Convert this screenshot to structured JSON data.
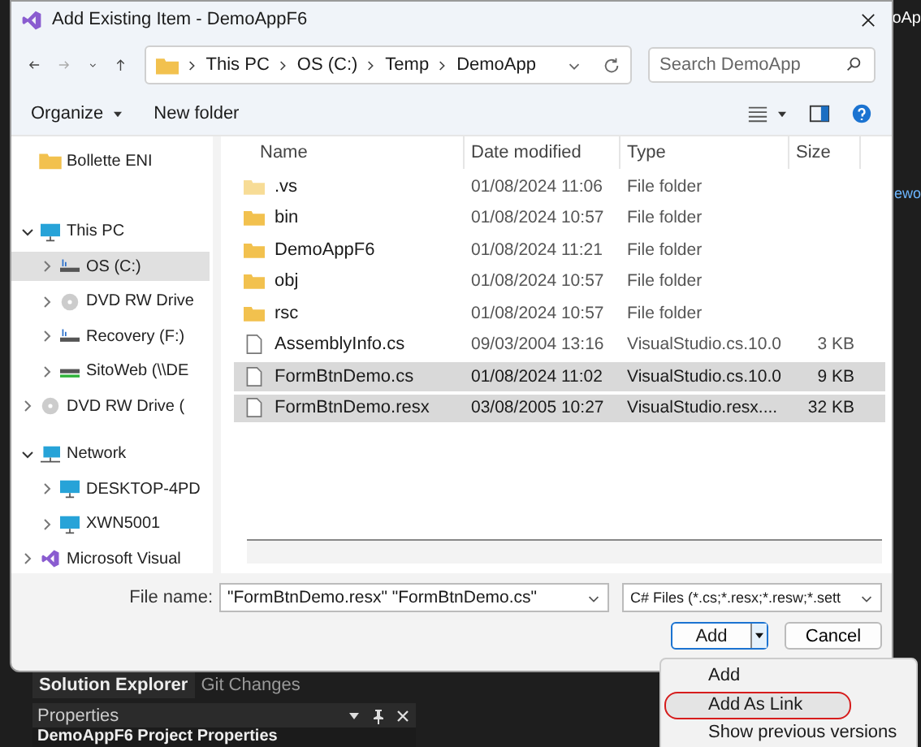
{
  "background": {
    "fragments": [
      "oAp",
      "ewo"
    ]
  },
  "window": {
    "title": "Add Existing Item - DemoAppF6"
  },
  "address": {
    "crumbs": [
      "This PC",
      "OS (C:)",
      "Temp",
      "DemoApp"
    ]
  },
  "search": {
    "placeholder": "Search DemoApp"
  },
  "toolbar": {
    "organize": "Organize",
    "new_folder": "New folder"
  },
  "sidebar": {
    "items": [
      {
        "label": "Bollette ENI",
        "kind": "folder",
        "selected": false
      },
      {
        "label": "This PC",
        "kind": "computer",
        "selected": false,
        "expanded": true,
        "children": [
          {
            "label": "OS (C:)",
            "kind": "drive",
            "selected": true,
            "expanded": false
          },
          {
            "label": "DVD RW Drive",
            "kind": "disc",
            "selected": false,
            "expanded": false
          },
          {
            "label": "Recovery (F:)",
            "kind": "drive",
            "selected": false,
            "expanded": false
          },
          {
            "label": "SitoWeb (\\\\DE",
            "kind": "share",
            "selected": false,
            "expanded": false
          }
        ]
      },
      {
        "label": "DVD RW Drive (",
        "kind": "disc",
        "selected": false,
        "expanded": false
      },
      {
        "label": "Network",
        "kind": "network",
        "selected": false,
        "expanded": true,
        "children": [
          {
            "label": "DESKTOP-4PD",
            "kind": "computer",
            "selected": false,
            "expanded": false
          },
          {
            "label": "XWN5001",
            "kind": "computer",
            "selected": false,
            "expanded": false
          }
        ]
      },
      {
        "label": "Microsoft Visual",
        "kind": "app",
        "selected": false,
        "expanded": false
      }
    ]
  },
  "table": {
    "columns": [
      "Name",
      "Date modified",
      "Type",
      "Size"
    ],
    "rows": [
      {
        "kind": "folder",
        "name": ".vs",
        "date": "01/08/2024 11:06",
        "type": "File folder",
        "selected": false
      },
      {
        "kind": "folder",
        "name": "bin",
        "date": "01/08/2024 10:57",
        "type": "File folder",
        "selected": false
      },
      {
        "kind": "folder",
        "name": "DemoAppF6",
        "date": "01/08/2024 11:21",
        "type": "File folder",
        "selected": false
      },
      {
        "kind": "folder",
        "name": "obj",
        "date": "01/08/2024 10:57",
        "type": "File folder",
        "selected": false
      },
      {
        "kind": "folder",
        "name": "rsc",
        "date": "01/08/2024 10:57",
        "type": "File folder",
        "selected": false
      },
      {
        "kind": "file",
        "name": "AssemblyInfo.cs",
        "date": "09/03/2004 13:16",
        "type": "VisualStudio.cs.10.0",
        "size": "3 KB",
        "selected": false
      },
      {
        "kind": "file",
        "name": "FormBtnDemo.cs",
        "date": "01/08/2024 11:02",
        "type": "VisualStudio.cs.10.0",
        "size": "9 KB",
        "selected": true
      },
      {
        "kind": "file",
        "name": "FormBtnDemo.resx",
        "date": "03/08/2005 10:27",
        "type": "VisualStudio.resx....",
        "size": "32 KB",
        "selected": true
      }
    ]
  },
  "file_name": {
    "label": "File name:",
    "value": "\"FormBtnDemo.resx\" \"FormBtnDemo.cs\""
  },
  "file_type": {
    "value": "C# Files (*.cs;*.resx;*.resw;*.sett"
  },
  "buttons": {
    "add": "Add",
    "cancel": "Cancel"
  },
  "menu": {
    "items": [
      {
        "label": "Add",
        "highlighted": false
      },
      {
        "label": "Add As Link",
        "highlighted": true
      },
      {
        "label": "Show previous versions",
        "highlighted": false
      }
    ]
  },
  "vs": {
    "tabs": [
      {
        "label": "Solution Explorer",
        "selected": true
      },
      {
        "label": "Git Changes",
        "selected": false
      }
    ],
    "properties": {
      "title": "Properties",
      "object": "DemoAppF6 Project Properties"
    }
  }
}
